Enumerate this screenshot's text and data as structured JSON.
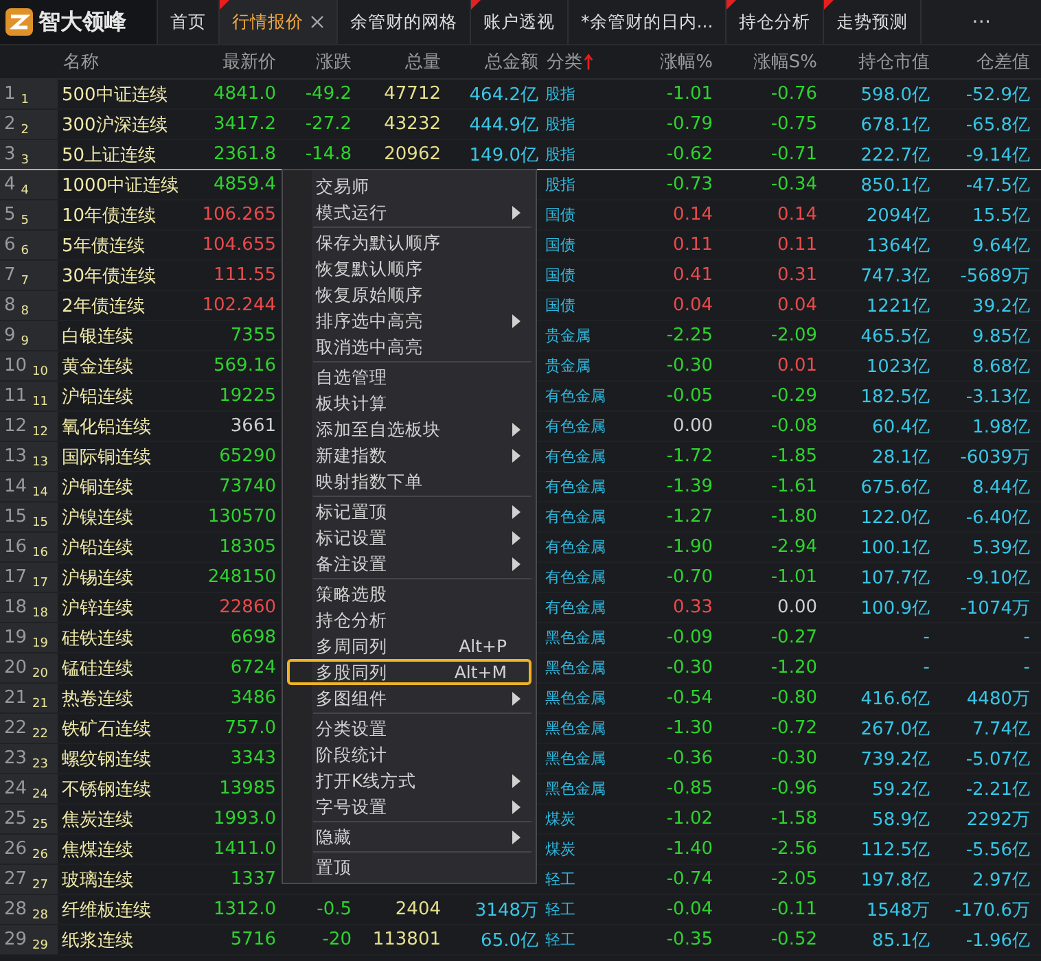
{
  "app": {
    "name": "智大领峰"
  },
  "tabs": [
    {
      "label": "首页",
      "selected": false,
      "flag": false,
      "closable": false
    },
    {
      "label": "行情报价",
      "selected": true,
      "flag": true,
      "closable": true
    },
    {
      "label": "余管财的网格",
      "selected": false,
      "flag": false,
      "closable": false
    },
    {
      "label": "账户透视",
      "selected": false,
      "flag": true,
      "closable": false
    },
    {
      "label": "*余管财的日内...",
      "selected": false,
      "flag": false,
      "closable": false
    },
    {
      "label": "持仓分析",
      "selected": false,
      "flag": true,
      "closable": false
    },
    {
      "label": "走势预测",
      "selected": false,
      "flag": true,
      "closable": false
    }
  ],
  "tab_overflow": "⋯",
  "table": {
    "columns": [
      {
        "label": "名称",
        "sorted_asc": false
      },
      {
        "label": "最新价",
        "sorted_asc": false
      },
      {
        "label": "涨跌",
        "sorted_asc": false
      },
      {
        "label": "总量",
        "sorted_asc": false
      },
      {
        "label": "总金额",
        "sorted_asc": false
      },
      {
        "label": "分类",
        "sorted_asc": true
      },
      {
        "label": "涨幅%",
        "sorted_asc": false
      },
      {
        "label": "涨幅S%",
        "sorted_asc": false
      },
      {
        "label": "持仓市值",
        "sorted_asc": false
      },
      {
        "label": "仓差值",
        "sorted_asc": false
      }
    ],
    "rows": [
      {
        "no": "1",
        "sub_no": "1",
        "divider_below": false,
        "name": "500中证连续",
        "price": {
          "text": "4841.0",
          "color": "#2ed32e"
        },
        "change": {
          "text": "-49.2",
          "color": "#2ed32e"
        },
        "volume": "47712",
        "amount": "464.2亿",
        "category": "股指",
        "pct": {
          "text": "-1.01",
          "color": "#2ed32e"
        },
        "pct_s": {
          "text": "-0.76",
          "color": "#2ed32e"
        },
        "holding": "598.0亿",
        "diff": "-52.9亿"
      },
      {
        "no": "2",
        "sub_no": "2",
        "divider_below": false,
        "name": "300沪深连续",
        "price": {
          "text": "3417.2",
          "color": "#2ed32e"
        },
        "change": {
          "text": "-27.2",
          "color": "#2ed32e"
        },
        "volume": "43232",
        "amount": "444.9亿",
        "category": "股指",
        "pct": {
          "text": "-0.79",
          "color": "#2ed32e"
        },
        "pct_s": {
          "text": "-0.75",
          "color": "#2ed32e"
        },
        "holding": "678.1亿",
        "diff": "-65.8亿"
      },
      {
        "no": "3",
        "sub_no": "3",
        "divider_below": true,
        "name": "50上证连续",
        "price": {
          "text": "2361.8",
          "color": "#2ed32e"
        },
        "change": {
          "text": "-14.8",
          "color": "#2ed32e"
        },
        "volume": "20962",
        "amount": "149.0亿",
        "category": "股指",
        "pct": {
          "text": "-0.62",
          "color": "#2ed32e"
        },
        "pct_s": {
          "text": "-0.71",
          "color": "#2ed32e"
        },
        "holding": "222.7亿",
        "diff": "-9.14亿"
      },
      {
        "no": "4",
        "sub_no": "4",
        "divider_below": false,
        "name": "1000中证连续",
        "price": {
          "text": "4859.4",
          "color": "#2ed32e"
        },
        "category": "股指",
        "pct": {
          "text": "-0.73",
          "color": "#2ed32e"
        },
        "pct_s": {
          "text": "-0.34",
          "color": "#2ed32e"
        },
        "holding": "850.1亿",
        "diff": "-47.5亿"
      },
      {
        "no": "5",
        "sub_no": "5",
        "divider_below": false,
        "name": "10年债连续",
        "price": {
          "text": "106.265",
          "color": "#ea4a4a"
        },
        "category": "国债",
        "pct": {
          "text": "0.14",
          "color": "#ea4a4a"
        },
        "pct_s": {
          "text": "0.14",
          "color": "#ea4a4a"
        },
        "holding": "2094亿",
        "diff": "15.5亿"
      },
      {
        "no": "6",
        "sub_no": "6",
        "divider_below": false,
        "name": "5年债连续",
        "price": {
          "text": "104.655",
          "color": "#ea4a4a"
        },
        "category": "国债",
        "pct": {
          "text": "0.11",
          "color": "#ea4a4a"
        },
        "pct_s": {
          "text": "0.11",
          "color": "#ea4a4a"
        },
        "holding": "1364亿",
        "diff": "9.64亿"
      },
      {
        "no": "7",
        "sub_no": "7",
        "divider_below": false,
        "name": "30年债连续",
        "price": {
          "text": "111.55",
          "color": "#ea4a4a"
        },
        "category": "国债",
        "pct": {
          "text": "0.41",
          "color": "#ea4a4a"
        },
        "pct_s": {
          "text": "0.31",
          "color": "#ea4a4a"
        },
        "holding": "747.3亿",
        "diff": "-5689万"
      },
      {
        "no": "8",
        "sub_no": "8",
        "divider_below": false,
        "name": "2年债连续",
        "price": {
          "text": "102.244",
          "color": "#ea4a4a"
        },
        "category": "国债",
        "pct": {
          "text": "0.04",
          "color": "#ea4a4a"
        },
        "pct_s": {
          "text": "0.04",
          "color": "#ea4a4a"
        },
        "holding": "1221亿",
        "diff": "39.2亿"
      },
      {
        "no": "9",
        "sub_no": "9",
        "divider_below": false,
        "name": "白银连续",
        "price": {
          "text": "7355",
          "color": "#2ed32e"
        },
        "category": "贵金属",
        "pct": {
          "text": "-2.25",
          "color": "#2ed32e"
        },
        "pct_s": {
          "text": "-2.09",
          "color": "#2ed32e"
        },
        "holding": "465.5亿",
        "diff": "9.85亿"
      },
      {
        "no": "10",
        "sub_no": "10",
        "divider_below": false,
        "name": "黄金连续",
        "price": {
          "text": "569.16",
          "color": "#2ed32e"
        },
        "category": "贵金属",
        "pct": {
          "text": "-0.30",
          "color": "#2ed32e"
        },
        "pct_s": {
          "text": "0.01",
          "color": "#ea4a4a"
        },
        "holding": "1023亿",
        "diff": "8.68亿"
      },
      {
        "no": "11",
        "sub_no": "11",
        "divider_below": false,
        "name": "沪铝连续",
        "price": {
          "text": "19225",
          "color": "#2ed32e"
        },
        "category": "有色金属",
        "pct": {
          "text": "-0.05",
          "color": "#2ed32e"
        },
        "pct_s": {
          "text": "-0.29",
          "color": "#2ed32e"
        },
        "holding": "182.5亿",
        "diff": "-3.13亿"
      },
      {
        "no": "12",
        "sub_no": "12",
        "divider_below": false,
        "name": "氧化铝连续",
        "price": {
          "text": "3661",
          "color": "#cfcfcf"
        },
        "category": "有色金属",
        "pct": {
          "text": "0.00",
          "color": "#cfcfcf"
        },
        "pct_s": {
          "text": "-0.08",
          "color": "#2ed32e"
        },
        "holding": "60.4亿",
        "diff": "1.98亿"
      },
      {
        "no": "13",
        "sub_no": "13",
        "divider_below": false,
        "name": "国际铜连续",
        "price": {
          "text": "65290",
          "color": "#2ed32e"
        },
        "category": "有色金属",
        "pct": {
          "text": "-1.72",
          "color": "#2ed32e"
        },
        "pct_s": {
          "text": "-1.85",
          "color": "#2ed32e"
        },
        "holding": "28.1亿",
        "diff": "-6039万"
      },
      {
        "no": "14",
        "sub_no": "14",
        "divider_below": false,
        "name": "沪铜连续",
        "price": {
          "text": "73740",
          "color": "#2ed32e"
        },
        "category": "有色金属",
        "pct": {
          "text": "-1.39",
          "color": "#2ed32e"
        },
        "pct_s": {
          "text": "-1.61",
          "color": "#2ed32e"
        },
        "holding": "675.6亿",
        "diff": "8.44亿"
      },
      {
        "no": "15",
        "sub_no": "15",
        "divider_below": false,
        "name": "沪镍连续",
        "price": {
          "text": "130570",
          "color": "#2ed32e"
        },
        "category": "有色金属",
        "pct": {
          "text": "-1.27",
          "color": "#2ed32e"
        },
        "pct_s": {
          "text": "-1.80",
          "color": "#2ed32e"
        },
        "holding": "122.0亿",
        "diff": "-6.40亿"
      },
      {
        "no": "16",
        "sub_no": "16",
        "divider_below": false,
        "name": "沪铅连续",
        "price": {
          "text": "18305",
          "color": "#2ed32e"
        },
        "category": "有色金属",
        "pct": {
          "text": "-1.90",
          "color": "#2ed32e"
        },
        "pct_s": {
          "text": "-2.94",
          "color": "#2ed32e"
        },
        "holding": "100.1亿",
        "diff": "5.39亿"
      },
      {
        "no": "17",
        "sub_no": "17",
        "divider_below": false,
        "name": "沪锡连续",
        "price": {
          "text": "248150",
          "color": "#2ed32e"
        },
        "category": "有色金属",
        "pct": {
          "text": "-0.70",
          "color": "#2ed32e"
        },
        "pct_s": {
          "text": "-1.01",
          "color": "#2ed32e"
        },
        "holding": "107.7亿",
        "diff": "-9.10亿"
      },
      {
        "no": "18",
        "sub_no": "18",
        "divider_below": false,
        "name": "沪锌连续",
        "price": {
          "text": "22860",
          "color": "#ea4a4a"
        },
        "category": "有色金属",
        "pct": {
          "text": "0.33",
          "color": "#ea4a4a"
        },
        "pct_s": {
          "text": "0.00",
          "color": "#cfcfcf"
        },
        "holding": "100.9亿",
        "diff": "-1074万"
      },
      {
        "no": "19",
        "sub_no": "19",
        "divider_below": false,
        "name": "硅铁连续",
        "price": {
          "text": "6698",
          "color": "#2ed32e"
        },
        "category": "黑色金属",
        "pct": {
          "text": "-0.09",
          "color": "#2ed32e"
        },
        "pct_s": {
          "text": "-0.27",
          "color": "#2ed32e"
        },
        "holding": "-",
        "diff": "-"
      },
      {
        "no": "20",
        "sub_no": "20",
        "divider_below": false,
        "name": "锰硅连续",
        "price": {
          "text": "6724",
          "color": "#2ed32e"
        },
        "category": "黑色金属",
        "pct": {
          "text": "-0.30",
          "color": "#2ed32e"
        },
        "pct_s": {
          "text": "-1.20",
          "color": "#2ed32e"
        },
        "holding": "-",
        "diff": "-"
      },
      {
        "no": "21",
        "sub_no": "21",
        "divider_below": false,
        "name": "热卷连续",
        "price": {
          "text": "3486",
          "color": "#2ed32e"
        },
        "category": "黑色金属",
        "pct": {
          "text": "-0.54",
          "color": "#2ed32e"
        },
        "pct_s": {
          "text": "-0.80",
          "color": "#2ed32e"
        },
        "holding": "416.6亿",
        "diff": "4480万"
      },
      {
        "no": "22",
        "sub_no": "22",
        "divider_below": false,
        "name": "铁矿石连续",
        "price": {
          "text": "757.0",
          "color": "#2ed32e"
        },
        "category": "黑色金属",
        "pct": {
          "text": "-1.30",
          "color": "#2ed32e"
        },
        "pct_s": {
          "text": "-0.72",
          "color": "#2ed32e"
        },
        "holding": "267.0亿",
        "diff": "7.74亿"
      },
      {
        "no": "23",
        "sub_no": "23",
        "divider_below": false,
        "name": "螺纹钢连续",
        "price": {
          "text": "3343",
          "color": "#2ed32e"
        },
        "category": "黑色金属",
        "pct": {
          "text": "-0.36",
          "color": "#2ed32e"
        },
        "pct_s": {
          "text": "-0.30",
          "color": "#2ed32e"
        },
        "holding": "739.2亿",
        "diff": "-5.07亿"
      },
      {
        "no": "24",
        "sub_no": "24",
        "divider_below": false,
        "name": "不锈钢连续",
        "price": {
          "text": "13985",
          "color": "#2ed32e"
        },
        "category": "黑色金属",
        "pct": {
          "text": "-0.85",
          "color": "#2ed32e"
        },
        "pct_s": {
          "text": "-0.96",
          "color": "#2ed32e"
        },
        "holding": "59.2亿",
        "diff": "-2.21亿"
      },
      {
        "no": "25",
        "sub_no": "25",
        "divider_below": false,
        "name": "焦炭连续",
        "price": {
          "text": "1993.0",
          "color": "#2ed32e"
        },
        "category": "煤炭",
        "pct": {
          "text": "-1.02",
          "color": "#2ed32e"
        },
        "pct_s": {
          "text": "-1.58",
          "color": "#2ed32e"
        },
        "holding": "58.9亿",
        "diff": "2292万"
      },
      {
        "no": "26",
        "sub_no": "26",
        "divider_below": false,
        "name": "焦煤连续",
        "price": {
          "text": "1411.0",
          "color": "#2ed32e"
        },
        "category": "煤炭",
        "pct": {
          "text": "-1.40",
          "color": "#2ed32e"
        },
        "pct_s": {
          "text": "-2.56",
          "color": "#2ed32e"
        },
        "holding": "112.5亿",
        "diff": "-5.56亿"
      },
      {
        "no": "27",
        "sub_no": "27",
        "divider_below": false,
        "name": "玻璃连续",
        "price": {
          "text": "1337",
          "color": "#2ed32e"
        },
        "category": "轻工",
        "pct": {
          "text": "-0.74",
          "color": "#2ed32e"
        },
        "pct_s": {
          "text": "-2.05",
          "color": "#2ed32e"
        },
        "holding": "197.8亿",
        "diff": "2.97亿"
      },
      {
        "no": "28",
        "sub_no": "28",
        "divider_below": false,
        "name": "纤维板连续",
        "price": {
          "text": "1312.0",
          "color": "#2ed32e"
        },
        "change": {
          "text": "-0.5",
          "color": "#2ed32e"
        },
        "volume": "2404",
        "amount": "3148万",
        "category": "轻工",
        "pct": {
          "text": "-0.04",
          "color": "#2ed32e"
        },
        "pct_s": {
          "text": "-0.11",
          "color": "#2ed32e"
        },
        "holding": "1548万",
        "diff": "-170.6万"
      },
      {
        "no": "29",
        "sub_no": "29",
        "divider_below": false,
        "name": "纸浆连续",
        "price": {
          "text": "5716",
          "color": "#2ed32e"
        },
        "change": {
          "text": "-20",
          "color": "#2ed32e"
        },
        "volume": "113801",
        "amount": "65.0亿",
        "category": "轻工",
        "pct": {
          "text": "-0.35",
          "color": "#2ed32e"
        },
        "pct_s": {
          "text": "-0.52",
          "color": "#2ed32e"
        },
        "holding": "85.1亿",
        "diff": "-1.96亿"
      }
    ]
  },
  "context_menu": {
    "groups": [
      [
        {
          "label": "交易师",
          "submenu": false,
          "selected": false
        },
        {
          "label": "模式运行",
          "submenu": true,
          "selected": false
        }
      ],
      [
        {
          "label": "保存为默认顺序",
          "submenu": false,
          "selected": false
        },
        {
          "label": "恢复默认顺序",
          "submenu": false,
          "selected": false
        },
        {
          "label": "恢复原始顺序",
          "submenu": false,
          "selected": false
        },
        {
          "label": "排序选中高亮",
          "submenu": true,
          "selected": false
        },
        {
          "label": "取消选中高亮",
          "submenu": false,
          "selected": false
        }
      ],
      [
        {
          "label": "自选管理",
          "submenu": false,
          "selected": false
        },
        {
          "label": "板块计算",
          "submenu": false,
          "selected": false
        },
        {
          "label": "添加至自选板块",
          "submenu": true,
          "selected": false
        },
        {
          "label": "新建指数",
          "submenu": true,
          "selected": false
        },
        {
          "label": "映射指数下单",
          "submenu": false,
          "selected": false
        }
      ],
      [
        {
          "label": "标记置顶",
          "submenu": true,
          "selected": false
        },
        {
          "label": "标记设置",
          "submenu": true,
          "selected": false
        },
        {
          "label": "备注设置",
          "submenu": true,
          "selected": false
        }
      ],
      [
        {
          "label": "策略选股",
          "submenu": false,
          "selected": false
        },
        {
          "label": "持仓分析",
          "submenu": false,
          "selected": false
        },
        {
          "label": "多周同列",
          "shortcut": "Alt+P",
          "submenu": false,
          "selected": false
        },
        {
          "label": "多股同列",
          "shortcut": "Alt+M",
          "submenu": false,
          "selected": true
        },
        {
          "label": "多图组件",
          "submenu": true,
          "selected": false
        }
      ],
      [
        {
          "label": "分类设置",
          "submenu": false,
          "selected": false
        },
        {
          "label": "阶段统计",
          "submenu": false,
          "selected": false
        },
        {
          "label": "打开K线方式",
          "submenu": true,
          "selected": false
        },
        {
          "label": "字号设置",
          "submenu": true,
          "selected": false
        }
      ],
      [
        {
          "label": "隐藏",
          "submenu": true,
          "selected": false
        }
      ],
      [
        {
          "label": "置顶",
          "submenu": false,
          "selected": false
        }
      ]
    ]
  }
}
